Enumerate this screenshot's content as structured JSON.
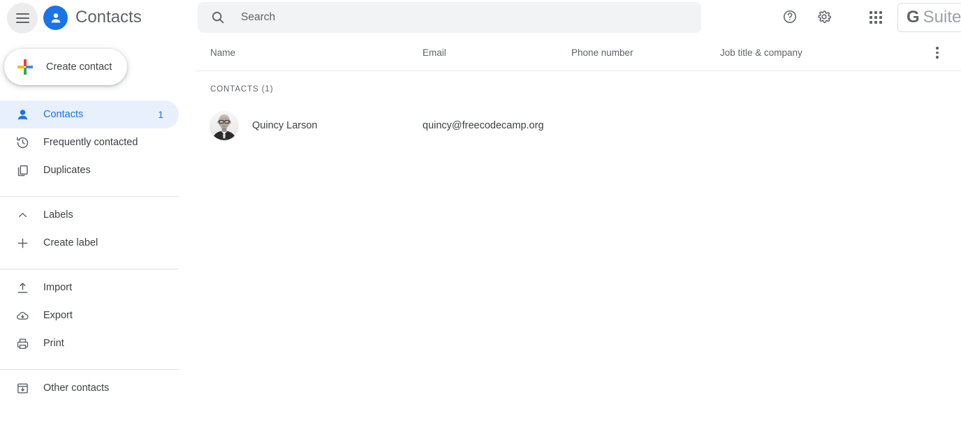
{
  "app": {
    "title": "Contacts",
    "brand_color": "#1a73e8",
    "accent_color": "#1a73e8",
    "active_pill_color": "#e8f0fe"
  },
  "topbar": {
    "menu_icon": "hamburger-icon",
    "logo_icon": "contacts-person-logo-icon",
    "help_icon": "help-circle-icon",
    "settings_icon": "gear-icon",
    "apps_icon": "apps-grid-icon",
    "gsuite_badge": {
      "g": "G",
      "word": "Suite"
    }
  },
  "search": {
    "placeholder": "Search",
    "value": "",
    "icon": "search-icon"
  },
  "sidebar": {
    "create_button": {
      "label": "Create contact",
      "icon": "google-plus-icon"
    },
    "items": [
      {
        "label": "Contacts",
        "icon": "person-outline-icon",
        "count": "1",
        "active": true
      },
      {
        "label": "Frequently contacted",
        "icon": "history-clock-icon",
        "count": "",
        "active": false
      },
      {
        "label": "Duplicates",
        "icon": "duplicate-pages-icon",
        "count": "",
        "active": false
      },
      {
        "label": "Labels",
        "icon": "chevron-up-icon",
        "count": "",
        "active": false
      },
      {
        "label": "Create label",
        "icon": "plus-icon",
        "count": "",
        "active": false
      },
      {
        "label": "Import",
        "icon": "upload-icon",
        "count": "",
        "active": false
      },
      {
        "label": "Export",
        "icon": "cloud-download-icon",
        "count": "",
        "active": false
      },
      {
        "label": "Print",
        "icon": "printer-icon",
        "count": "",
        "active": false
      },
      {
        "label": "Other contacts",
        "icon": "archive-box-icon",
        "count": "",
        "active": false
      }
    ]
  },
  "main": {
    "columns": [
      {
        "label": "Name"
      },
      {
        "label": "Email"
      },
      {
        "label": "Phone number"
      },
      {
        "label": "Job title & company"
      }
    ],
    "more_menu_icon": "more-vertical-icon",
    "section_label": "CONTACTS (1)",
    "rows": [
      {
        "avatar": "contact-photo-avatar",
        "name": "Quincy Larson",
        "email": "quincy@freecodecamp.org",
        "phone": "",
        "job": ""
      }
    ]
  }
}
